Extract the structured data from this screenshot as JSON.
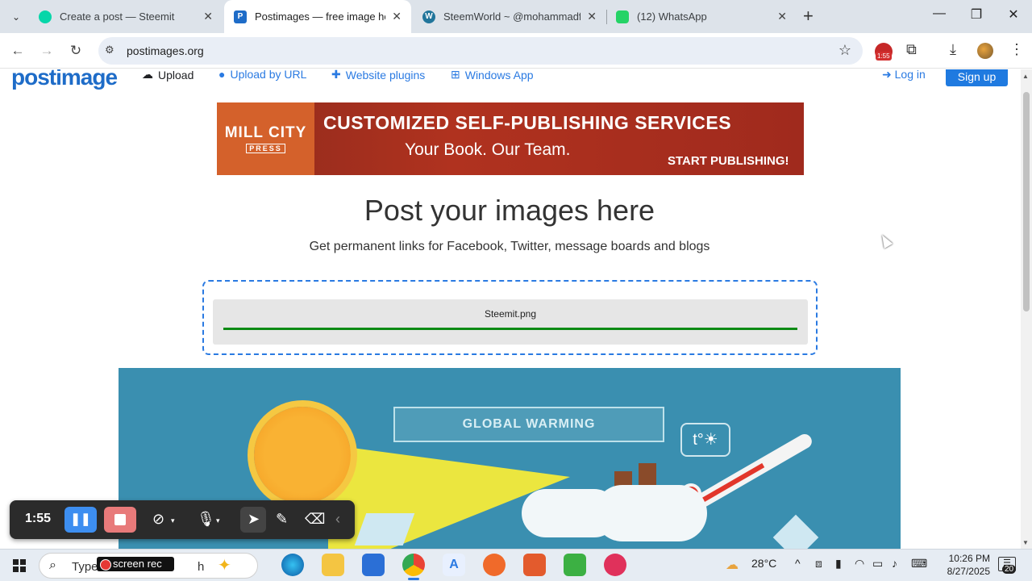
{
  "browser": {
    "tabs": [
      {
        "title": "Create a post — Steemit",
        "active": false,
        "favicon_color": "#06d6a9"
      },
      {
        "title": "Postimages — free image hosti",
        "active": true,
        "favicon_color": "#1e6cc8"
      },
      {
        "title": "SteemWorld ~ @mohammadfa",
        "active": false,
        "favicon_color": "#21759b"
      },
      {
        "title": "(12) WhatsApp",
        "active": false,
        "favicon_color": "#25d366"
      }
    ],
    "new_tab": "+",
    "url": "postimages.org",
    "recording_badge": "1:55"
  },
  "site": {
    "logo": "postimage",
    "nav": {
      "upload": "Upload",
      "upload_by_url": "Upload by URL",
      "website_plugins": "Website plugins",
      "windows_app": "Windows App",
      "login": "Log in",
      "signup": "Sign up"
    },
    "banner": {
      "brand_line1": "MILL CITY",
      "brand_line2": "PRESS",
      "headline": "CUSTOMIZED SELF-PUBLISHING SERVICES",
      "subline": "Your Book. Our Team.",
      "cta": "START PUBLISHING!"
    },
    "hero_title": "Post your images here",
    "hero_subtitle": "Get permanent links for Facebook, Twitter, message boards and blogs",
    "upload": {
      "filename": "Steemit.png",
      "progress": 1.0,
      "progress_color": "#0d8a14"
    },
    "preview": {
      "label": "GLOBAL WARMING",
      "thermo_badge": "t°☀"
    }
  },
  "recorder": {
    "time": "1:55"
  },
  "taskbar": {
    "search_text": "Type",
    "search_text_end": "h",
    "screenrec_label": "screen rec",
    "weather": "28°C",
    "time": "10:26 PM",
    "date": "8/27/2025",
    "notifications": "20"
  },
  "colors": {
    "accent": "#1e6cc8",
    "link": "#2a7ae2",
    "signup_bg": "#1f7ae0",
    "preview_bg": "#3a8fb0"
  }
}
